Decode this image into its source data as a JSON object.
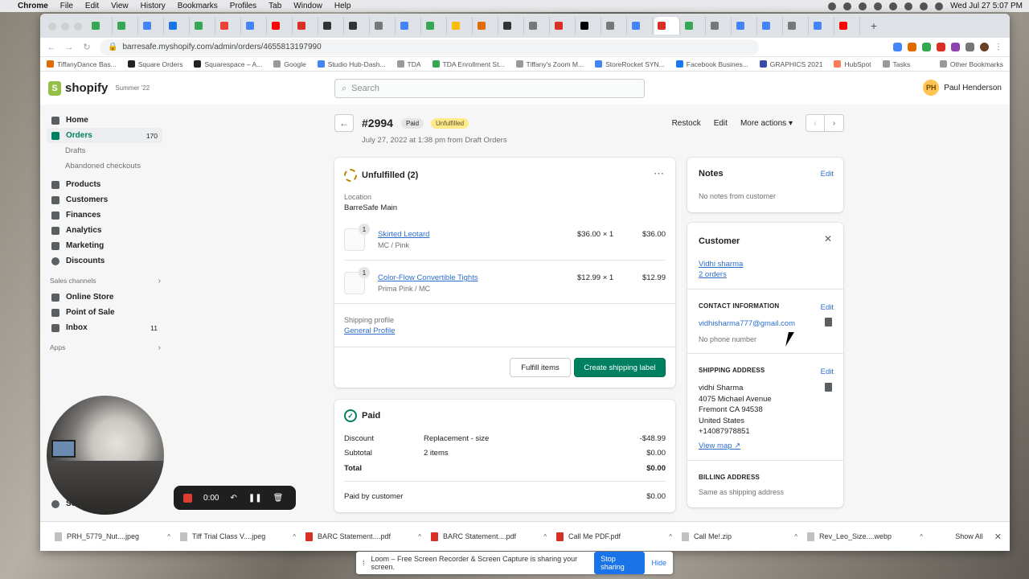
{
  "menubar": {
    "apple": "",
    "items": [
      "Chrome",
      "File",
      "Edit",
      "View",
      "History",
      "Bookmarks",
      "Profiles",
      "Tab",
      "Window",
      "Help"
    ],
    "clock": "Wed Jul 27  5:07 PM"
  },
  "browser": {
    "url": "barresafe.myshopify.com/admin/orders/4655813197990",
    "tab_favicon_colors": [
      "#34a853",
      "#34a853",
      "#4285f4",
      "#1a73e8",
      "#34a853",
      "#ea4335",
      "#4285f4",
      "#ff0000",
      "#d93025",
      "#333333",
      "#333333",
      "#777777",
      "#4285f4",
      "#34a853",
      "#fbbc05",
      "#e06c00",
      "#333333",
      "#777777",
      "#d93025",
      "#000000",
      "#777777",
      "#4285f4",
      "#d93025",
      "#34a853",
      "#777777",
      "#4285f4",
      "#4285f4",
      "#777777",
      "#4285f4",
      "#ff0000"
    ],
    "bookmarks": [
      "TiffanyDance Bas...",
      "Square Orders",
      "Squarespace – A...",
      "Google",
      "Studio Hub-Dash...",
      "TDA",
      "TDA Enrollment St...",
      "Tiffany's Zoom M...",
      "StoreRocket SYN...",
      "Facebook Busines...",
      "GRAPHICS 2021",
      "HubSpot",
      "Tasks"
    ],
    "other_bookmarks": "Other Bookmarks"
  },
  "shopify": {
    "logo": "shopify",
    "edition": "Summer '22",
    "search_placeholder": "Search",
    "user_initials": "PH",
    "user_name": "Paul Henderson"
  },
  "sidebar": {
    "home": "Home",
    "orders": "Orders",
    "orders_count": "170",
    "drafts": "Drafts",
    "abandoned": "Abandoned checkouts",
    "products": "Products",
    "customers": "Customers",
    "finances": "Finances",
    "analytics": "Analytics",
    "marketing": "Marketing",
    "discounts": "Discounts",
    "sales_channels": "Sales channels",
    "online_store": "Online Store",
    "pos": "Point of Sale",
    "inbox": "Inbox",
    "inbox_count": "11",
    "apps": "Apps",
    "settings": "Se"
  },
  "recorder": {
    "time": "0:00"
  },
  "order": {
    "number": "#2994",
    "badge_paid": "Paid",
    "badge_unfulfilled": "Unfulfilled",
    "meta": "July 27, 2022 at 1:38 pm from Draft Orders",
    "restock": "Restock",
    "edit": "Edit",
    "more_actions": "More actions"
  },
  "unfulfilled": {
    "title": "Unfulfilled (2)",
    "location_label": "Location",
    "location": "BarreSafe Main",
    "items": [
      {
        "qty": "1",
        "name": "Skirted Leotard",
        "variant": "MC / Pink",
        "unit": "$36.00 × 1",
        "total": "$36.00"
      },
      {
        "qty": "1",
        "name": "Color-Flow Convertible Tights",
        "variant": "Prima Pink / MC",
        "unit": "$12.99 × 1",
        "total": "$12.99"
      }
    ],
    "shipping_profile_label": "Shipping profile",
    "shipping_profile": "General Profile",
    "fulfill": "Fulfill items",
    "create_label": "Create shipping label"
  },
  "paid": {
    "title": "Paid",
    "rows": [
      {
        "label": "Discount",
        "desc": "Replacement - size",
        "amount": "-$48.99"
      },
      {
        "label": "Subtotal",
        "desc": "2 items",
        "amount": "$0.00"
      },
      {
        "label": "Total",
        "desc": "",
        "amount": "$0.00"
      }
    ],
    "paid_by_label": "Paid by customer",
    "paid_by_amount": "$0.00"
  },
  "notes": {
    "title": "Notes",
    "edit": "Edit",
    "text": "No notes from customer"
  },
  "customer": {
    "title": "Customer",
    "name": "Vidhi sharma",
    "orders": "2 orders",
    "contact_head": "CONTACT INFORMATION",
    "edit": "Edit",
    "email": "vidhisharma777@gmail.com",
    "phone": "No phone number",
    "shipping_head": "SHIPPING ADDRESS",
    "address": [
      "vidhi Sharma",
      "4075 Michael Avenue",
      "Fremont CA 94538",
      "United States",
      "+14087978851"
    ],
    "view_map": "View map",
    "billing_head": "BILLING ADDRESS",
    "billing": "Same as shipping address"
  },
  "downloads": {
    "files": [
      "PRH_5779_Nut....jpeg",
      "Tiff Trial Class V....jpeg",
      "BARC Statement....pdf",
      "BARC Statement....pdf",
      "Call Me PDF.pdf",
      "Call Me!.zip",
      "Rev_Leo_Size....webp"
    ],
    "show_all": "Show All"
  },
  "loom": {
    "message": "Loom – Free Screen Recorder & Screen Capture is sharing your screen.",
    "stop": "Stop sharing",
    "hide": "Hide"
  }
}
